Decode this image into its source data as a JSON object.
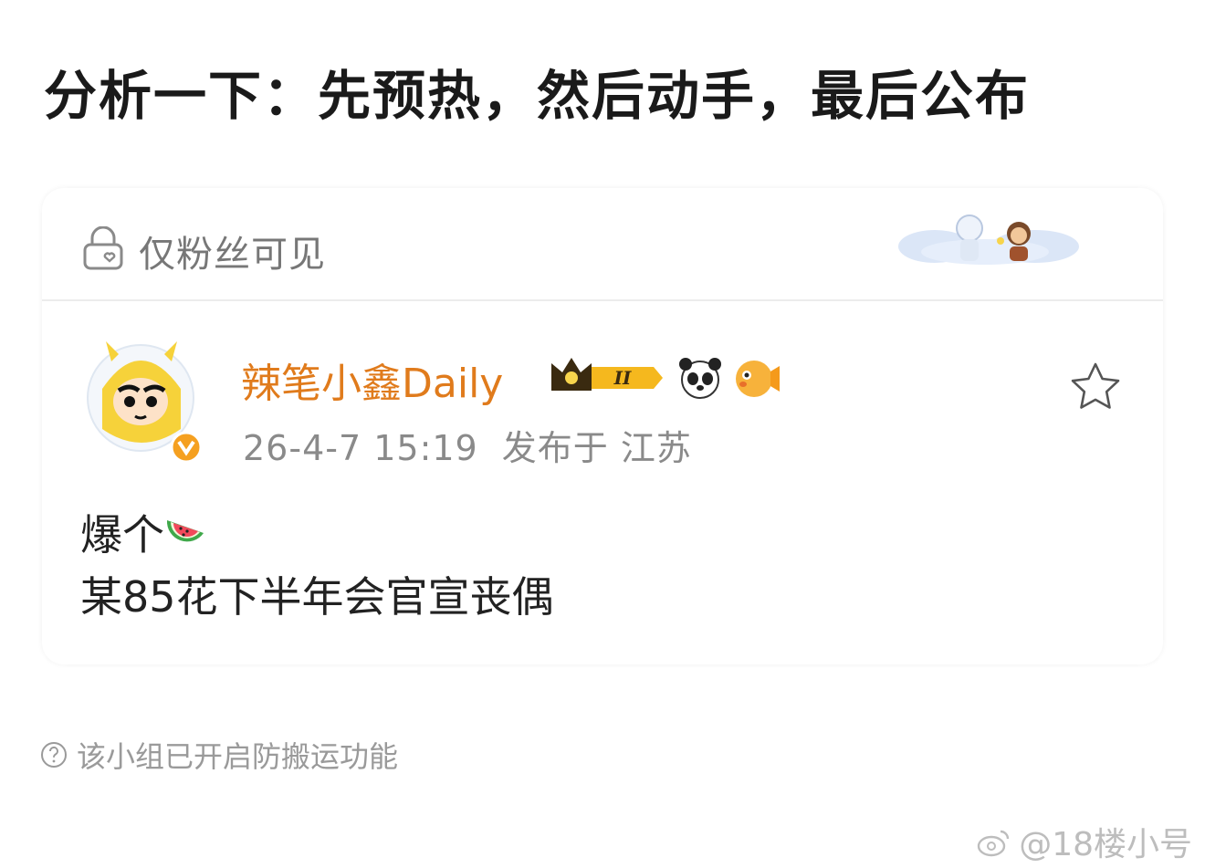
{
  "headline": "分析一下：先预热，然后动手，最后公布",
  "post": {
    "visibility": "仅粉丝可见",
    "author": "辣笔小鑫Daily",
    "level_badge": "II",
    "timestamp": "26-4-7 15:19",
    "location": "发布于 江苏",
    "body_lines": [
      "爆个",
      "某85花下半年会官宣丧偶"
    ],
    "body_emoji": "watermelon-emoji"
  },
  "footer": {
    "notice": "该小组已开启防搬运功能"
  },
  "watermark": {
    "text": "@18楼小号"
  },
  "colors": {
    "username": "#e07b1c",
    "secondary": "#8a8a8a",
    "divider": "#ececec"
  },
  "icons": {
    "visibility": "lock-icon",
    "favorite": "star-icon",
    "help": "question-circle-icon",
    "verified": "verified-v-icon"
  }
}
